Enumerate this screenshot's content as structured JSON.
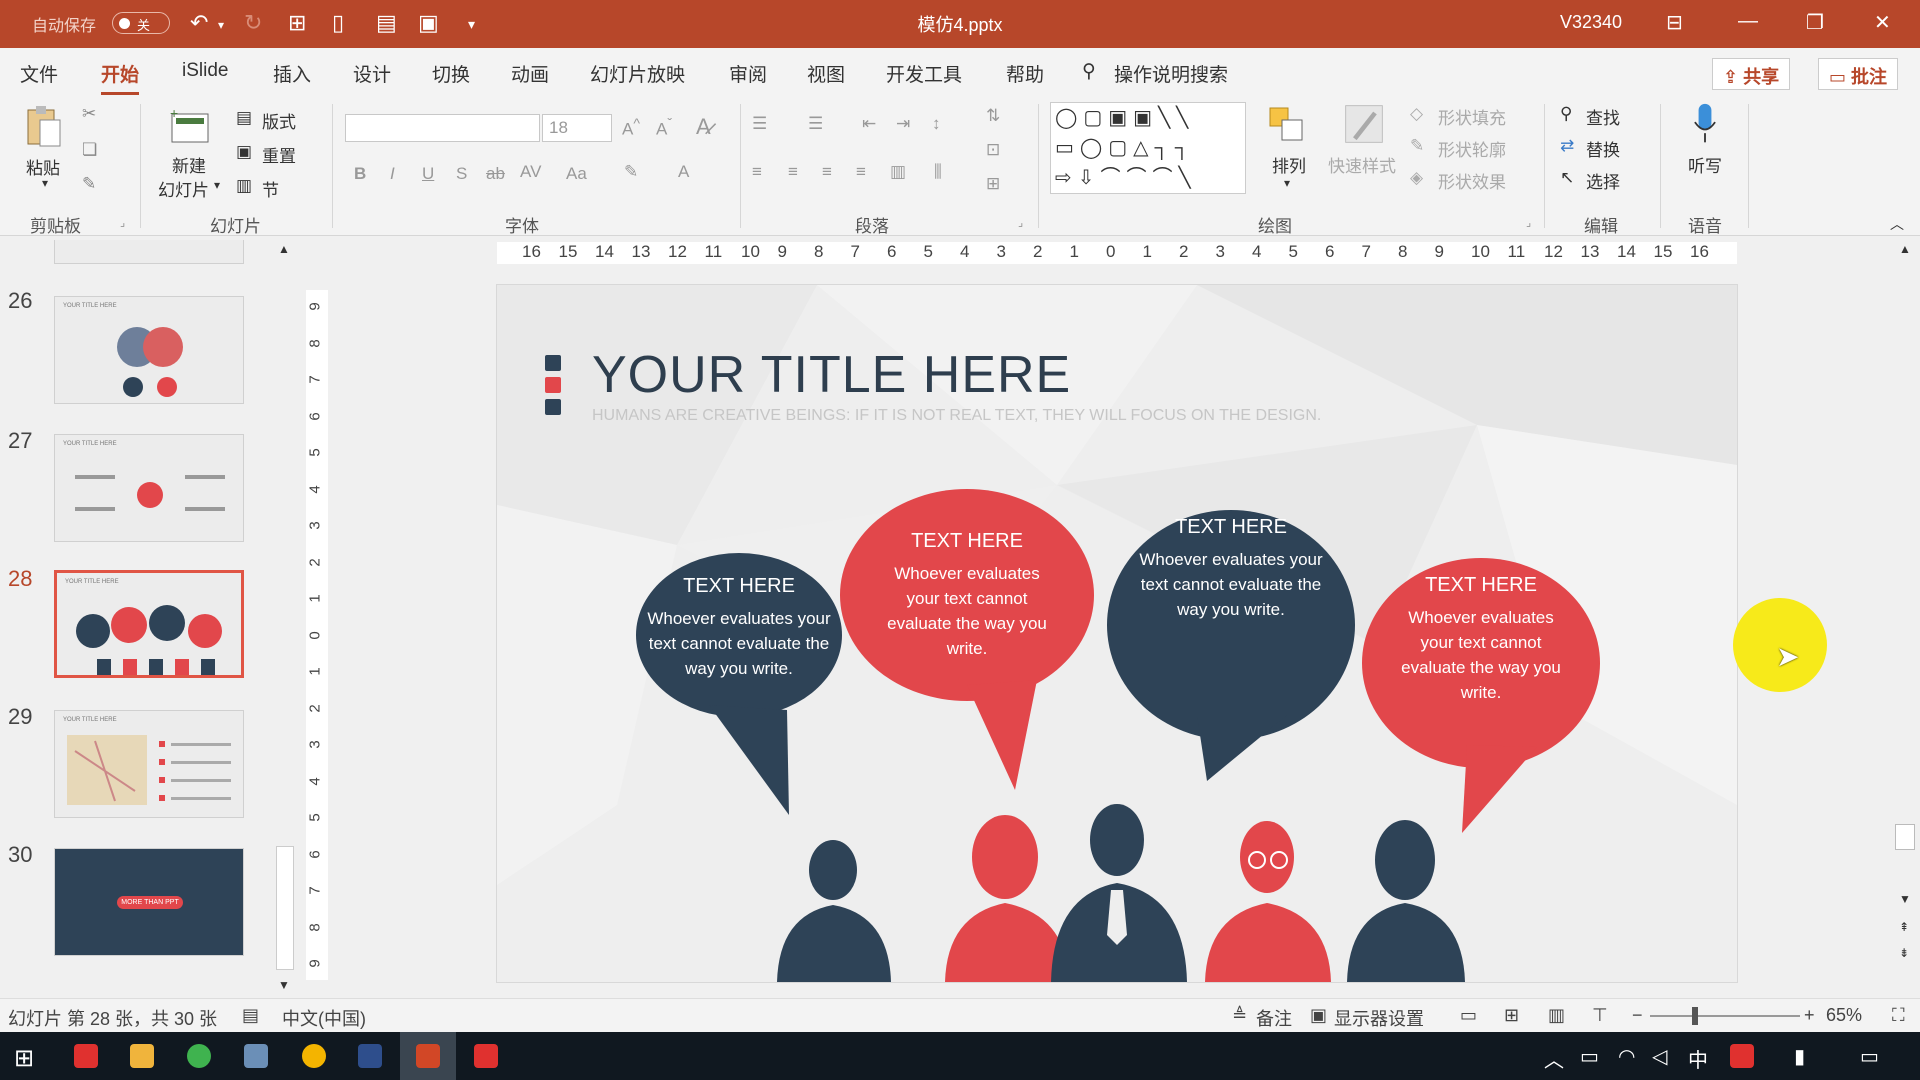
{
  "titlebar": {
    "autosave": "自动保存",
    "toggle": "关",
    "filename": "模仿4.pptx",
    "user": "V32340"
  },
  "tabs": [
    "文件",
    "开始",
    "iSlide",
    "插入",
    "设计",
    "切换",
    "动画",
    "幻灯片放映",
    "审阅",
    "视图",
    "开发工具",
    "帮助"
  ],
  "search": "操作说明搜索",
  "share": "共享",
  "comment": "批注",
  "ribbon": {
    "paste": "粘贴",
    "new_slide_1": "新建",
    "new_slide_2": "幻灯片",
    "layout": "版式",
    "reset": "重置",
    "section": "节",
    "font_size": "18",
    "arrange": "排列",
    "quick_styles": "快速样式",
    "shape_fill": "形状填充",
    "shape_outline": "形状轮廓",
    "shape_effects": "形状效果",
    "find": "查找",
    "replace": "替换",
    "select": "选择",
    "dictate": "听写",
    "groups": {
      "clipboard": "剪贴板",
      "slides": "幻灯片",
      "font": "字体",
      "paragraph": "段落",
      "drawing": "绘图",
      "editing": "编辑",
      "voice": "语音"
    }
  },
  "thumbnails": [
    {
      "num": "26",
      "title": "YOUR TITLE HERE"
    },
    {
      "num": "27",
      "title": "YOUR TITLE HERE"
    },
    {
      "num": "28",
      "title": "YOUR TITLE HERE"
    },
    {
      "num": "29",
      "title": "YOUR TITLE HERE"
    },
    {
      "num": "30",
      "title": "MORE THAN PPT"
    }
  ],
  "hruler": [
    "16",
    "15",
    "14",
    "13",
    "12",
    "11",
    "10",
    "9",
    "8",
    "7",
    "6",
    "5",
    "4",
    "3",
    "2",
    "1",
    "0",
    "1",
    "2",
    "3",
    "4",
    "5",
    "6",
    "7",
    "8",
    "9",
    "10",
    "11",
    "12",
    "13",
    "14",
    "15",
    "16"
  ],
  "vruler": [
    "9",
    "8",
    "7",
    "6",
    "5",
    "4",
    "3",
    "2",
    "1",
    "0",
    "1",
    "2",
    "3",
    "4",
    "5",
    "6",
    "7",
    "8",
    "9"
  ],
  "slide": {
    "title": "YOUR TITLE HERE",
    "subtitle": "HUMANS ARE CREATIVE BEINGS: IF IT IS NOT REAL TEXT, THEY WILL FOCUS ON THE DESIGN.",
    "bubbles": [
      {
        "heading": "TEXT HERE",
        "body": "Whoever evaluates your text cannot evaluate the way you write."
      },
      {
        "heading": "TEXT HERE",
        "body": "Whoever evaluates your text cannot evaluate the way you write."
      },
      {
        "heading": "TEXT HERE",
        "body": "Whoever evaluates your text cannot evaluate the way you write."
      },
      {
        "heading": "TEXT HERE",
        "body": "Whoever evaluates your text cannot evaluate the way you write."
      }
    ],
    "colors": {
      "dark": "#2e4357",
      "red": "#e2474b"
    }
  },
  "status": {
    "slide_info": "幻灯片 第 28 张，共 30 张",
    "language": "中文(中国)",
    "notes": "备注",
    "display_settings": "显示器设置",
    "zoom": "65%"
  },
  "taskbar": {
    "ime": "中"
  }
}
